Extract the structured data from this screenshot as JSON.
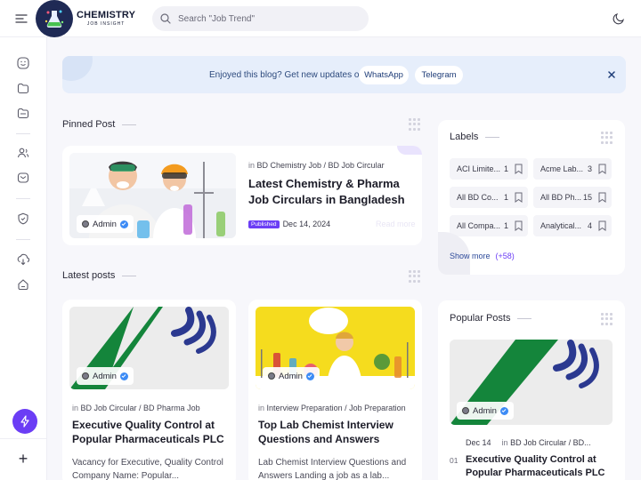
{
  "header": {
    "logo_main": "CHEMISTRY",
    "logo_sub": "JOB INSIGHT",
    "search_placeholder": "Search \"Job Trend\""
  },
  "notification": {
    "text": "Enjoyed this blog? Get new updates on",
    "whatsapp": "WhatsApp",
    "telegram": "Telegram"
  },
  "pinned": {
    "heading": "Pinned Post",
    "author": "Admin",
    "category_prefix": "in",
    "categories": "BD Chemistry Job / BD Job Circular",
    "title": "Latest Chemistry & Pharma Job Circulars in Bangladesh",
    "badge": "Published",
    "date": "Dec 14, 2024",
    "read_more": "Read more"
  },
  "latest": {
    "heading": "Latest posts",
    "posts": [
      {
        "author": "Admin",
        "category_prefix": "in",
        "categories": "BD Job Circular / BD Pharma Job",
        "title": "Executive Quality Control at Popular Pharmaceuticals PLC",
        "snippet": "Vacancy for Executive, Quality Control Company Name: Popular..."
      },
      {
        "author": "Admin",
        "category_prefix": "in",
        "categories": "Interview Preparation / Job Preparation",
        "title": "Top Lab Chemist Interview Questions and Answers",
        "snippet": "Lab Chemist Interview Questions and Answers Landing a job as a lab..."
      }
    ]
  },
  "labels": {
    "heading": "Labels",
    "items": [
      {
        "name": "ACI Limite...",
        "count": "1"
      },
      {
        "name": "Acme Lab...",
        "count": "3"
      },
      {
        "name": "All BD Co...",
        "count": "1"
      },
      {
        "name": "All BD Ph...",
        "count": "15"
      },
      {
        "name": "All Compa...",
        "count": "1"
      },
      {
        "name": "Analytical...",
        "count": "4"
      }
    ],
    "show_more": "Show more",
    "more_count": "(+58)"
  },
  "popular": {
    "heading": "Popular Posts",
    "author": "Admin",
    "date": "Dec 14",
    "category_prefix": "in",
    "categories": "BD Job Circular / BD...",
    "rank": "01",
    "title": "Executive Quality Control at Popular Pharmaceuticals PLC"
  },
  "colors": {
    "accent": "#6b3df5",
    "notify_bg": "#e6eefb",
    "verify": "#3d8bf5",
    "popular_green": "#14853b",
    "popular_blue": "#2b3990"
  }
}
